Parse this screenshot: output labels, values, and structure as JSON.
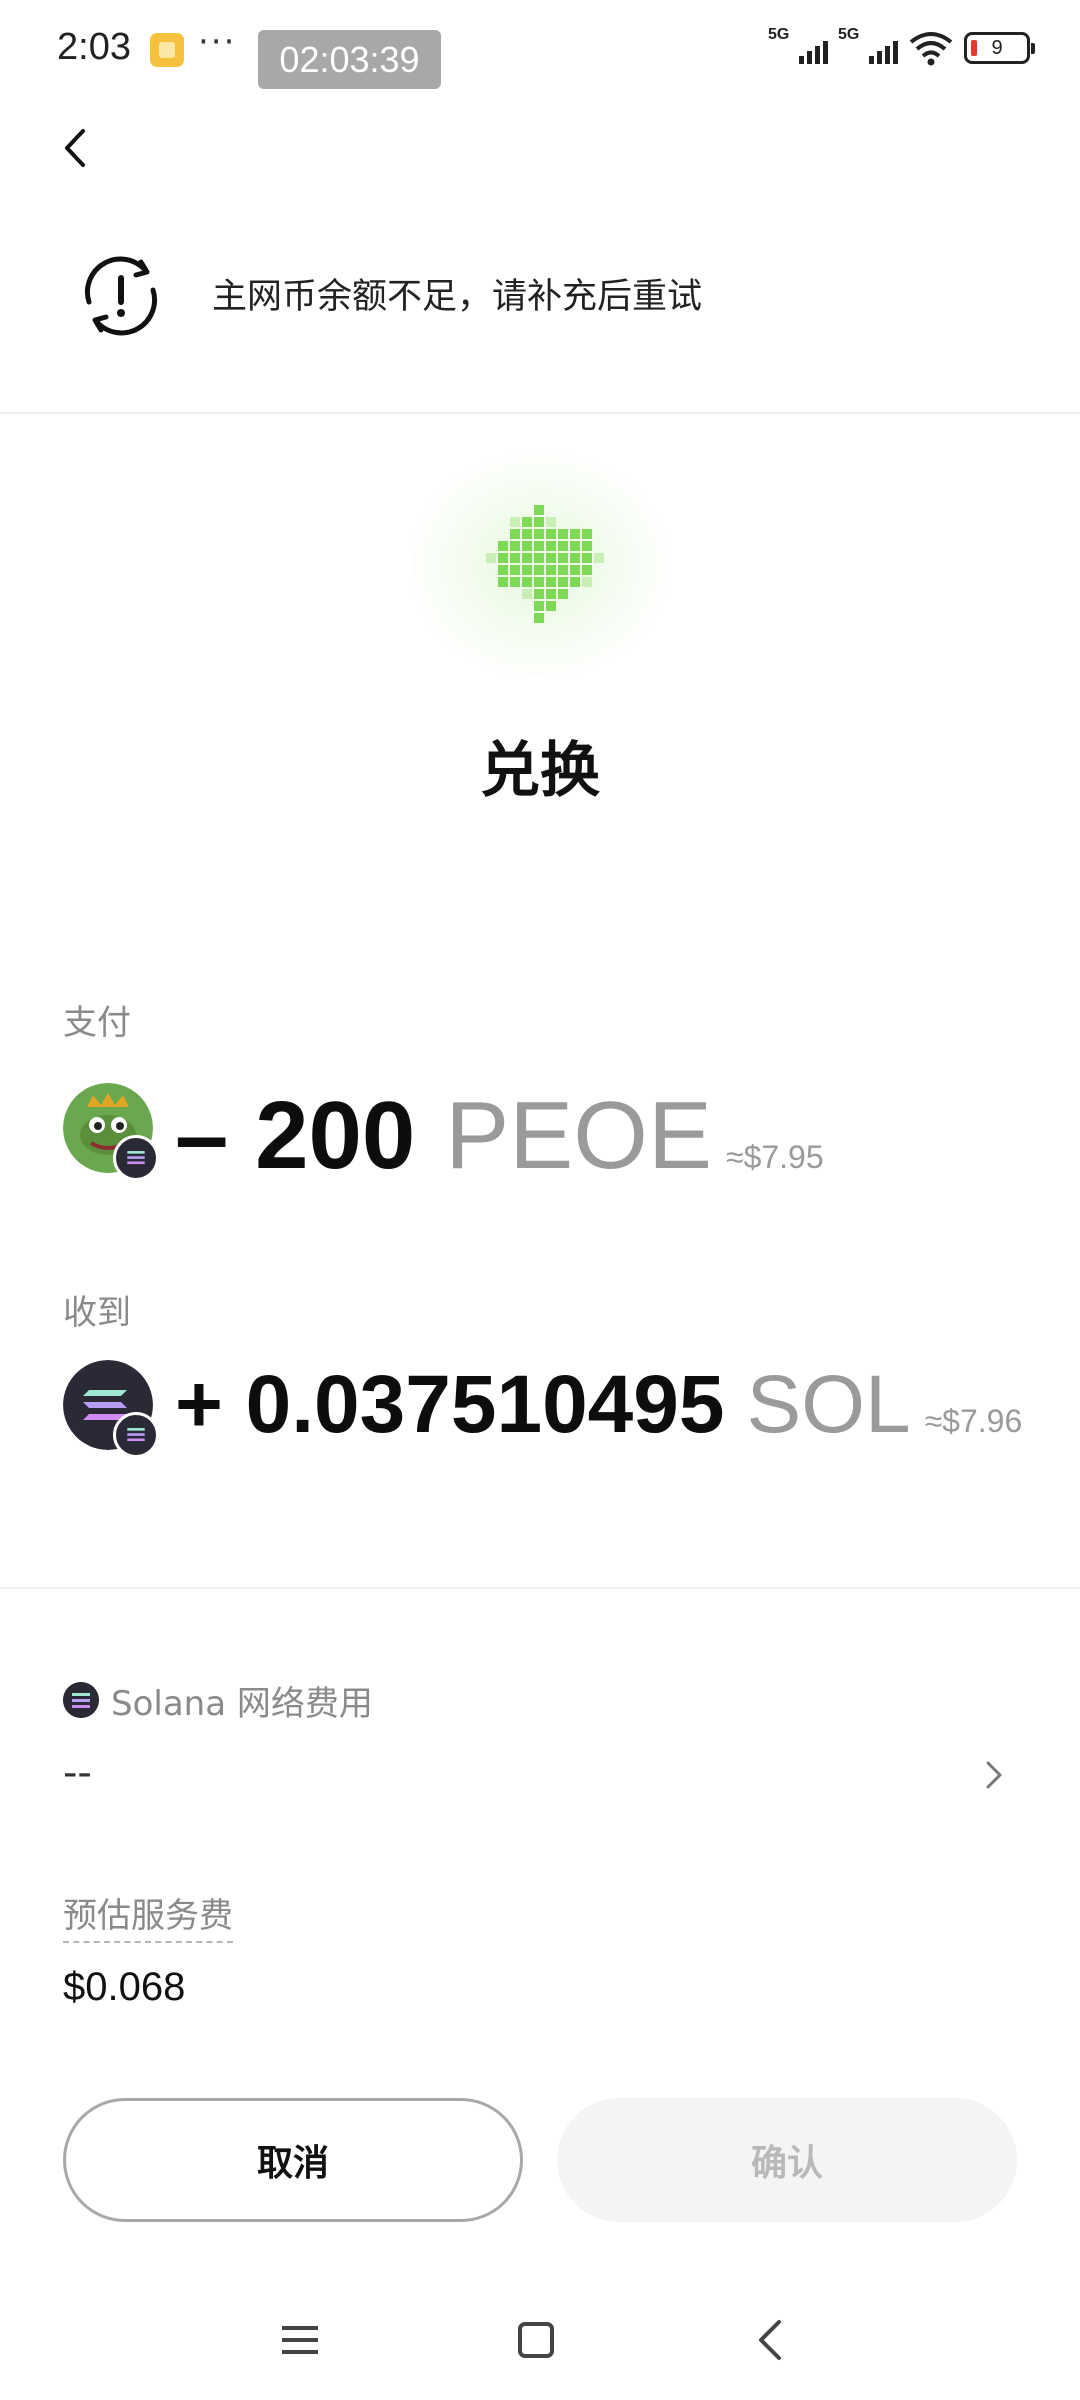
{
  "status_bar": {
    "time": "2:03",
    "dots": "···",
    "timer": "02:03:39",
    "signal_1_label": "5G",
    "signal_2_label": "5G",
    "battery": "9"
  },
  "header": {
    "alert_text": "主网币余额不足，请补充后重试"
  },
  "hero": {
    "title": "兑换"
  },
  "pay": {
    "label": "支付",
    "amount": "– 200",
    "symbol": "PEOE",
    "usd": "≈$7.95"
  },
  "receive": {
    "label": "收到",
    "amount": "+ 0.037510495",
    "symbol": "SOL",
    "usd": "≈$7.96"
  },
  "network_fee": {
    "label": "Solana 网络费用",
    "value": "--"
  },
  "service_fee": {
    "label": "预估服务费",
    "value": "$0.068"
  },
  "actions": {
    "cancel_label": "取消",
    "confirm_label": "确认"
  },
  "colors": {
    "accent_green": "#7ed957",
    "disabled_text": "#b9b9b9",
    "muted_text": "#8a8a8a"
  }
}
